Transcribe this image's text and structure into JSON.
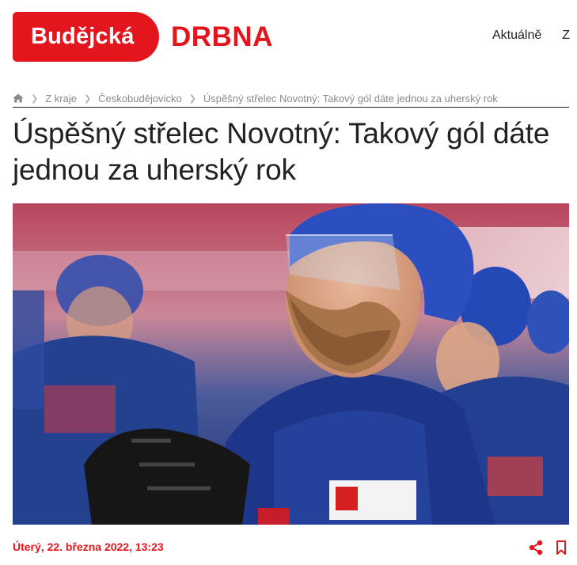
{
  "header": {
    "logo_part1": "Budějcká",
    "logo_part2": "DRBNA",
    "nav": [
      "Aktuálně",
      "Z"
    ]
  },
  "breadcrumb": {
    "home_icon": "home-icon",
    "items": [
      "Z kraje",
      "Českobudějovicko",
      "Úspěšný střelec Novotný: Takový gól dáte jednou za uherský rok"
    ]
  },
  "article": {
    "title": "Úspěšný střelec Novotný: Takový gól dáte jednou za uherský rok",
    "date": "Úterý, 22. března 2022, 13:23",
    "share_icon": "share-icon",
    "bookmark_icon": "bookmark-icon"
  },
  "colors": {
    "brand_red": "#e3151d",
    "text": "#222222",
    "muted": "#8a8a8a"
  }
}
